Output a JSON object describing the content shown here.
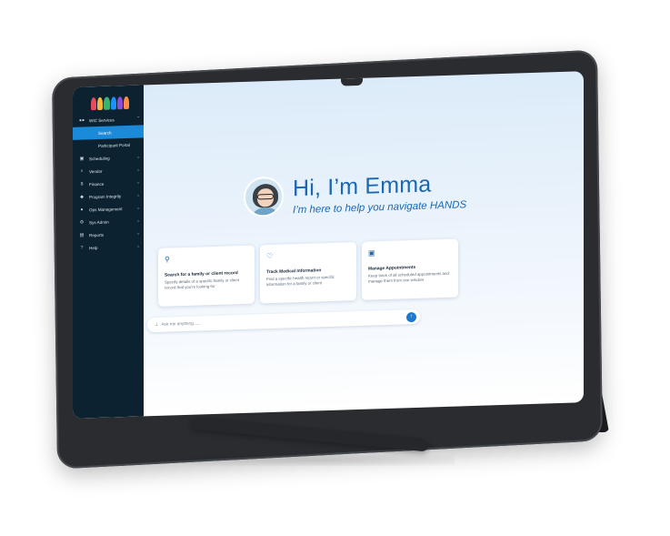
{
  "app": {
    "brand_colors": [
      "#e84a5f",
      "#f6b73c",
      "#3cb371",
      "#1e90ff",
      "#8a4fd8",
      "#ff8c42"
    ]
  },
  "sidebar": {
    "items": [
      {
        "label": "WIC Services",
        "icon": "users-icon",
        "chevron": "^",
        "level": 0
      },
      {
        "label": "Search",
        "icon": "",
        "chevron": "",
        "level": 1,
        "active": true
      },
      {
        "label": "Participant Portal",
        "icon": "",
        "chevron": "",
        "level": 1
      },
      {
        "label": "Scheduling",
        "icon": "calendar-icon",
        "chevron": "v",
        "level": 0
      },
      {
        "label": "Vendor",
        "icon": "cart-icon",
        "chevron": "v",
        "level": 0
      },
      {
        "label": "Finance",
        "icon": "dollar-icon",
        "chevron": "v",
        "level": 0
      },
      {
        "label": "Program Integrity",
        "icon": "lock-icon",
        "chevron": "v",
        "level": 0
      },
      {
        "label": "Ops Management",
        "icon": "people-icon",
        "chevron": "v",
        "level": 0
      },
      {
        "label": "Sys Admin",
        "icon": "gear-icon",
        "chevron": "v",
        "level": 0
      },
      {
        "label": "Reports",
        "icon": "chart-icon",
        "chevron": "v",
        "level": 0
      },
      {
        "label": "Help",
        "icon": "help-icon",
        "chevron": "v",
        "level": 0
      }
    ]
  },
  "hero": {
    "title": "Hi, I’m Emma",
    "subtitle": "I’m here to help you navigate HANDS"
  },
  "cards": [
    {
      "icon": "search-icon",
      "title": "Search for a family or client record",
      "desc": "Specify details of a specific family or client record that you're looking for"
    },
    {
      "icon": "heartbeat-icon",
      "title": "Track Medical Information",
      "desc": "Find a specific health report or specific information for a family or client"
    },
    {
      "icon": "calendar-icon",
      "title": "Manage Appointments",
      "desc": "Keep track of all scheduled appointments and manage them from one window"
    }
  ],
  "ask": {
    "placeholder": "Ask me anything......"
  }
}
